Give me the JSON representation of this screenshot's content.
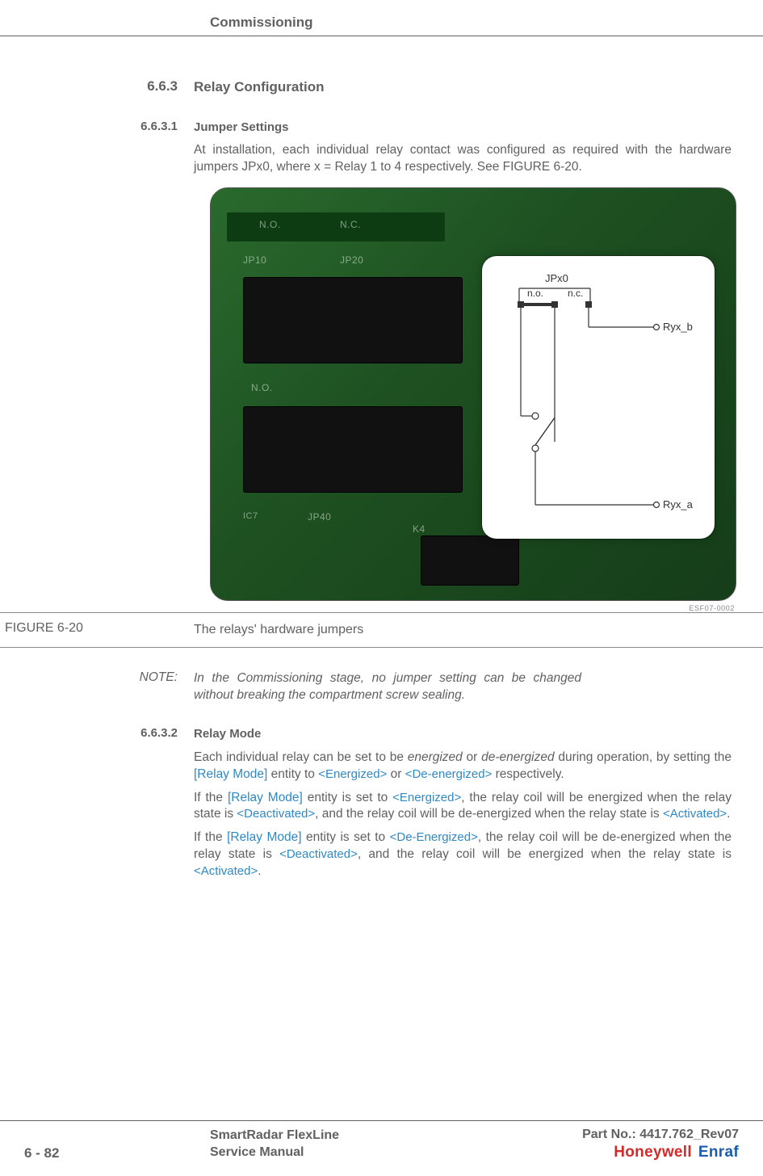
{
  "header": {
    "chapter": "Commissioning"
  },
  "s1": {
    "num": "6.6.3",
    "title": "Relay Configuration"
  },
  "s11": {
    "num": "6.6.3.1",
    "title": "Jumper Settings",
    "p1": "At installation, each individual relay contact was configured as required with the hardware jumpers JPx0, where x = Relay 1 to 4 respectively. See FIGURE 6-20."
  },
  "figure": {
    "label": "FIGURE  6-20",
    "caption": "The relays' hardware jumpers",
    "code": "ESF07-0002",
    "diagram": {
      "jumper": "JPx0",
      "no": "n.o.",
      "nc": "n.c.",
      "out_b": "Ryx_b",
      "out_a": "Ryx_a"
    }
  },
  "note": {
    "label": "NOTE:",
    "body": "In the Commissioning stage, no jumper setting can be changed without breaking the compartment screw sealing."
  },
  "s12": {
    "num": "6.6.3.2",
    "title": "Relay Mode",
    "p1a": "Each individual relay can be set to be ",
    "p1_em1": "energized",
    "p1b": " or ",
    "p1_em2": "de-energized",
    "p1c": " during operation, by setting the ",
    "entity1": "[Relay Mode]",
    "p1d": " entity to ",
    "val1": "<Energized>",
    "p1e": " or ",
    "val2": "<De-energized>",
    "p1f": " respectively.",
    "p2a": "If the ",
    "p2b": " entity is set to ",
    "p2c": ", the relay coil will be energized when the relay state is ",
    "val3": "<Deactivated>",
    "p2d": ", and the relay coil will be de-energized when the relay state is ",
    "val4": "<Activated>",
    "p2e": ".",
    "p3a": "If the ",
    "p3b": " entity is set to ",
    "val5": "<De-Energized>",
    "p3c": ", the relay coil will be de-energized when the relay state is ",
    "p3d": ", and the relay coil will be energized when the relay state is ",
    "p3e": "."
  },
  "footer": {
    "page": "6 - 82",
    "title1": "SmartRadar FlexLine",
    "title2": "Service Manual",
    "part": "Part No.: 4417.762_Rev07",
    "brand1": "Honeywell",
    "brand2": "Enraf"
  }
}
